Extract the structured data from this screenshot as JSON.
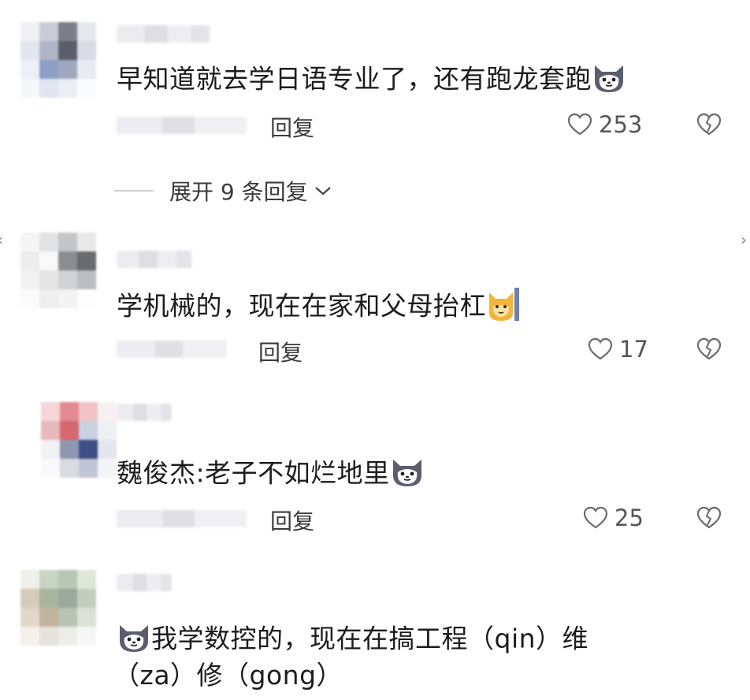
{
  "comments": [
    {
      "text": "早知道就去学日语专业了，还有跑龙套跑",
      "reply": "回复",
      "likes": "253",
      "emoji": "husky-emoji"
    },
    {
      "text": "学机械的，现在在家和父母抬杠",
      "reply": "回复",
      "likes": "17",
      "emoji": "cat-emoji"
    },
    {
      "text": "魏俊杰:老子不如烂地里",
      "reply": "回复",
      "likes": "25",
      "emoji": "husky-emoji"
    },
    {
      "text_line1": "我学数控的，现在在搞工程（qin）维",
      "text_line2": "（za）修（gong）",
      "emoji": "husky-emoji"
    }
  ],
  "expand_replies": "展开 9 条回复",
  "colors": {
    "text": "#1c1c1c",
    "icon": "#6b6b6b",
    "background": "#ffffff"
  }
}
